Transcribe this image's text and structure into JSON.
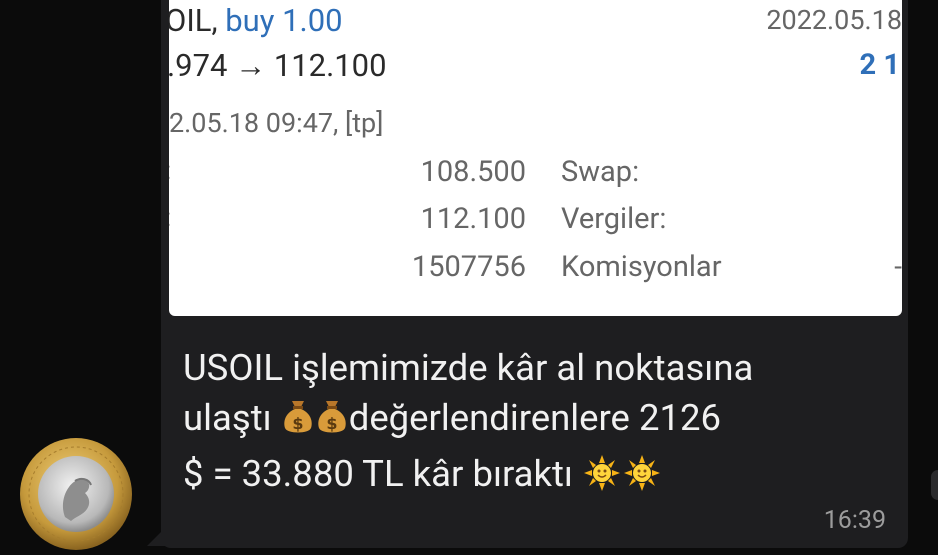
{
  "trade_screenshot": {
    "symbol_prefix": "OIL,",
    "side": "buy 1.00",
    "open_date": "2022.05.18",
    "price_change": ".974 → 112.100",
    "profit_partial": "2 1",
    "close_time": "2.05.18 09:47, [tp]",
    "rows": [
      {
        "value": "108.500",
        "label": "Swap:"
      },
      {
        "value": "112.100",
        "label": "Vergiler:"
      },
      {
        "value": "1507756",
        "label": "Komisyonlar"
      }
    ],
    "row_edge_char": "-"
  },
  "message": {
    "line1": "USOIL işlemimizde kâr al noktasına",
    "line2_a": "ulaştı",
    "line2_b": "değerlendirenlere 2126",
    "line3": "$ = 33.880 TL kâr bıraktı",
    "time": "16:39"
  },
  "icons": {
    "emoji_1": "money-bag",
    "emoji_2": "sun"
  },
  "colors": {
    "chat_bg": "#0b0b0b",
    "bubble_bg": "#1e1e20",
    "accent_blue": "#2f6fb8",
    "coin_gold": "#c9a44a",
    "coin_silver": "#c9c9c9"
  }
}
